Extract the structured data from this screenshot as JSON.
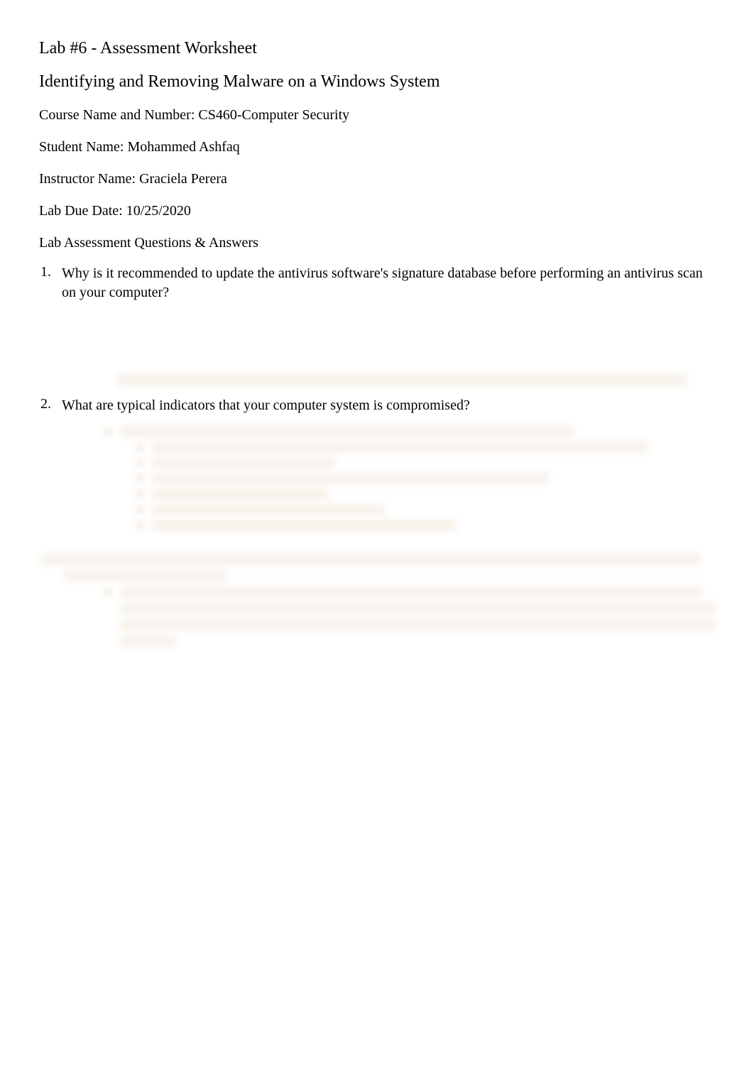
{
  "doc": {
    "title": "Lab #6 - Assessment Worksheet",
    "subtitle": "Identifying and Removing Malware on a Windows System",
    "course_label": "Course Name and Number: ",
    "course_value": "CS460-Computer Security",
    "student_label": "Student Name: ",
    "student_value": "Mohammed Ashfaq",
    "instructor_label": "Instructor Name: ",
    "instructor_value": "Graciela Perera",
    "due_label": "Lab Due Date: ",
    "due_value": "10/25/2020",
    "qa_heading": "Lab Assessment Questions & Answers",
    "questions": [
      {
        "num": "1.",
        "text": "Why is it recommended to update the antivirus software's signature database before performing an antivirus scan on your computer?"
      },
      {
        "num": "2.",
        "text": "What are typical indicators that your computer system is compromised?"
      }
    ]
  }
}
